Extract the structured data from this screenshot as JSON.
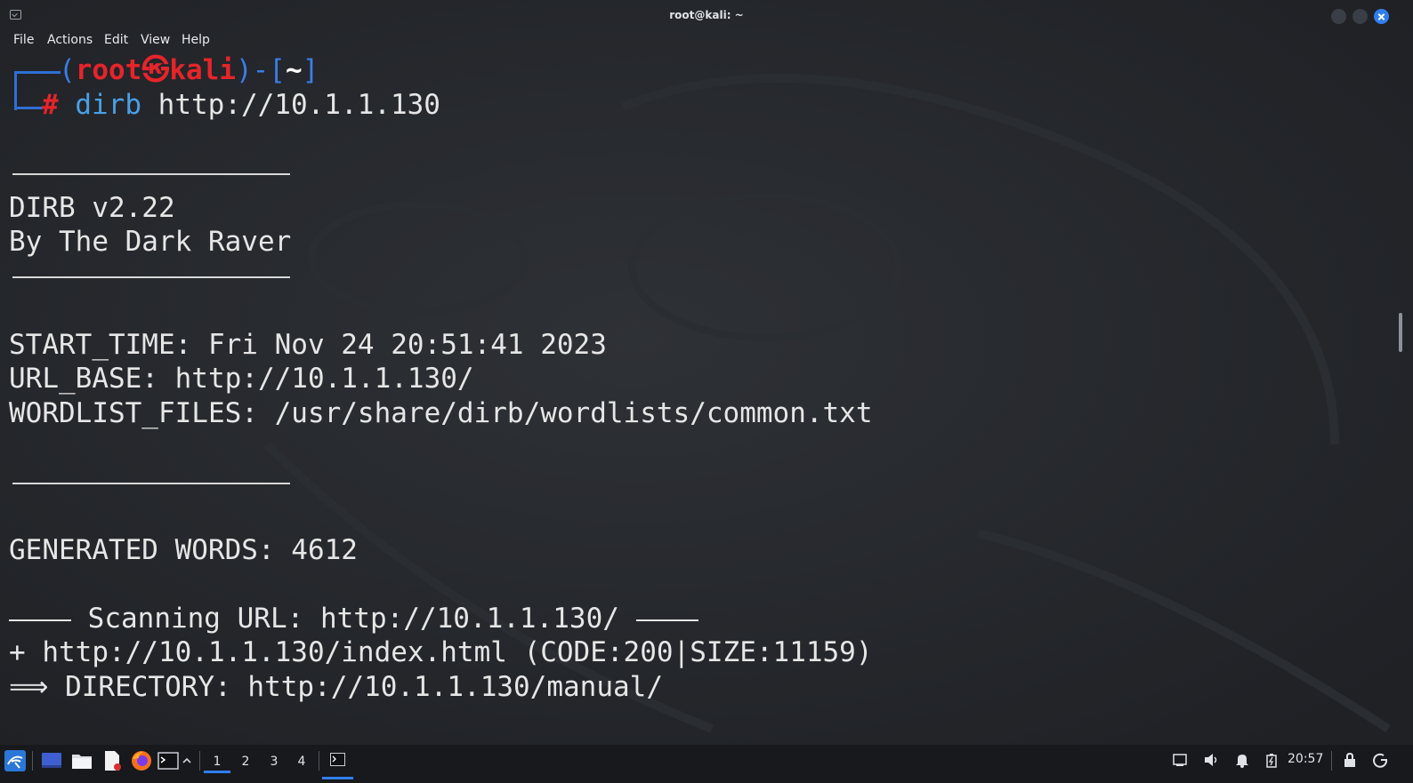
{
  "window": {
    "title": "root@kali: ~"
  },
  "menu": [
    "File",
    "Actions",
    "Edit",
    "View",
    "Help"
  ],
  "prompt": {
    "open": "(",
    "user": "root",
    "at_symbol": "㉿",
    "host": "kali",
    "close": ")-[",
    "dir": "~",
    "dir_close": "]",
    "hash": "#",
    "command": "dirb",
    "argument": " http://10.1.1.130"
  },
  "output": {
    "banner_name": "DIRB v2.22",
    "banner_author": "By The Dark Raver",
    "start_time": "START_TIME: Fri Nov 24 20:51:41 2023",
    "url_base": "URL_BASE: http://10.1.1.130/",
    "wordlist": "WORDLIST_FILES: /usr/share/dirb/wordlists/common.txt",
    "generated_words": "GENERATED WORDS: 4612",
    "scanning": " Scanning URL: http://10.1.1.130/ ",
    "found": "+ http://10.1.1.130/index.html (CODE:200|SIZE:11159)",
    "directory": "⟹ DIRECTORY: http://10.1.1.130/manual/"
  },
  "taskbar": {
    "workspaces": [
      "1",
      "2",
      "3",
      "4"
    ],
    "active_workspace": "1",
    "clock": "20:57",
    "icons": [
      "kali-menu-icon",
      "desktop-icon",
      "file-manager-icon",
      "text-editor-icon",
      "firefox-icon",
      "terminal-icon",
      "chevron-up-icon",
      "terminal-task-icon",
      "network-icon",
      "volume-icon",
      "notification-bell-icon",
      "battery-icon",
      "lock-icon",
      "power-icon"
    ]
  },
  "colors": {
    "prompt_frame": "#2f6fd6",
    "prompt_user": "#e5252a",
    "command": "#4aa0e6",
    "accent": "#2f7ef0",
    "terminal_bg": "#22252a"
  }
}
